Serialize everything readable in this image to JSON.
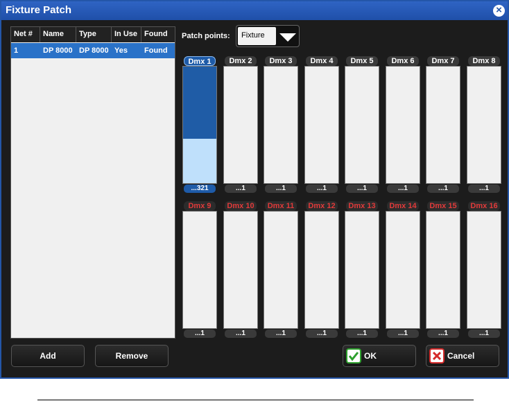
{
  "window": {
    "title": "Fixture Patch",
    "close_icon": "close-circle-icon"
  },
  "fixture_list": {
    "columns": [
      "Net #",
      "Name",
      "Type",
      "In Use",
      "Found"
    ],
    "rows": [
      [
        "1",
        "DP 8000",
        "DP 8000",
        "Yes",
        "Found"
      ]
    ],
    "selected_color": "#2a72c8"
  },
  "patch_points": {
    "label": "Patch points:",
    "selected": "Fixture"
  },
  "dmx": {
    "row1": [
      {
        "label": "Dmx 1",
        "footer": "...321",
        "state": "active",
        "dark_fill": 0.62,
        "light_fill": 0.38
      },
      {
        "label": "Dmx 2",
        "footer": "...1",
        "state": "normal"
      },
      {
        "label": "Dmx 3",
        "footer": "...1",
        "state": "normal"
      },
      {
        "label": "Dmx 4",
        "footer": "...1",
        "state": "normal"
      },
      {
        "label": "Dmx 5",
        "footer": "...1",
        "state": "normal"
      },
      {
        "label": "Dmx 6",
        "footer": "...1",
        "state": "normal"
      },
      {
        "label": "Dmx 7",
        "footer": "...1",
        "state": "normal"
      },
      {
        "label": "Dmx 8",
        "footer": "...1",
        "state": "normal"
      }
    ],
    "row2": [
      {
        "label": "Dmx 9",
        "footer": "...1",
        "state": "missing"
      },
      {
        "label": "Dmx 10",
        "footer": "...1",
        "state": "missing"
      },
      {
        "label": "Dmx 11",
        "footer": "...1",
        "state": "missing"
      },
      {
        "label": "Dmx 12",
        "footer": "...1",
        "state": "missing"
      },
      {
        "label": "Dmx 13",
        "footer": "...1",
        "state": "missing"
      },
      {
        "label": "Dmx 14",
        "footer": "...1",
        "state": "missing"
      },
      {
        "label": "Dmx 15",
        "footer": "...1",
        "state": "missing"
      },
      {
        "label": "Dmx 16",
        "footer": "...1",
        "state": "missing"
      }
    ]
  },
  "buttons": {
    "add": "Add",
    "remove": "Remove",
    "ok": "OK",
    "cancel": "Cancel"
  },
  "colors": {
    "titlebar": "#2456a8",
    "missing_label": "#e03a3a",
    "ok_icon": "#2da02d",
    "cancel_icon": "#d42a2a"
  }
}
